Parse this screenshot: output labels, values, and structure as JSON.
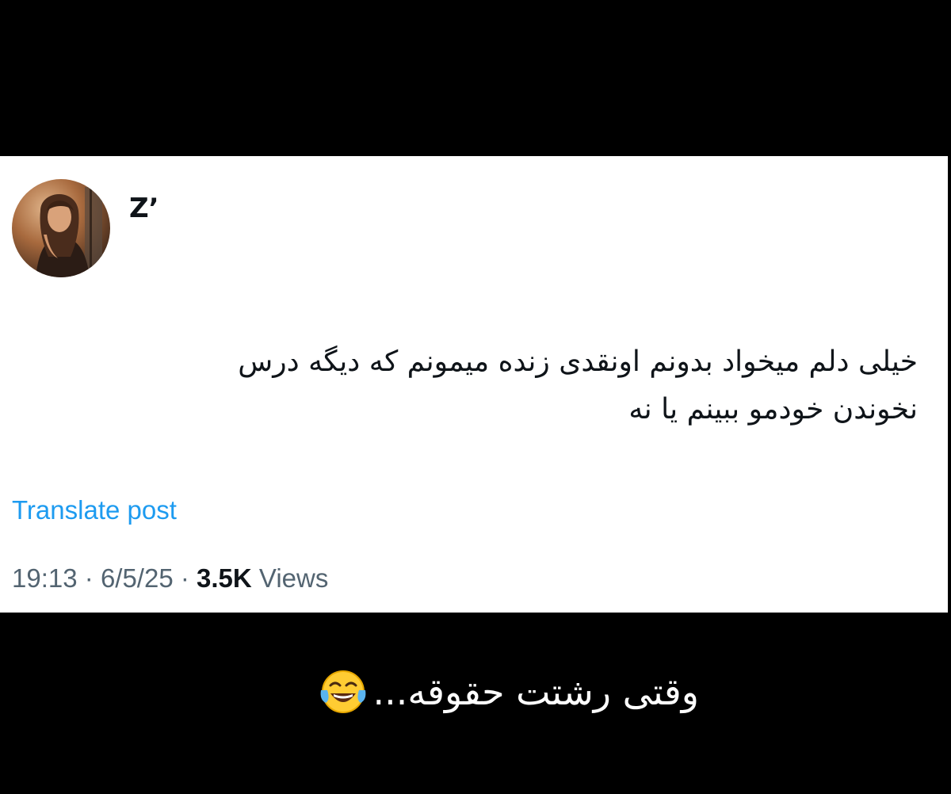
{
  "tweet": {
    "author": {
      "display_name": "Z’",
      "avatar_icon": "profile-photo"
    },
    "text_lines": [
      "خیلی دلم میخواد بدونم اونقدی زنده میمونم که دیگه درس",
      "نخوندن خودمو ببینم یا نه"
    ],
    "translate_label": "Translate post",
    "meta": {
      "time": "19:13",
      "separator": "·",
      "date": "6/5/25",
      "views_count": "3.5K",
      "views_label": "Views"
    }
  },
  "caption": {
    "text": "وقتی رشتت حقوقه...",
    "emoji_icon": "tears-of-joy-emoji"
  },
  "colors": {
    "background": "#000000",
    "card": "#ffffff",
    "link": "#1d9bf0",
    "meta_text": "#536471",
    "primary_text": "#0f1419"
  }
}
